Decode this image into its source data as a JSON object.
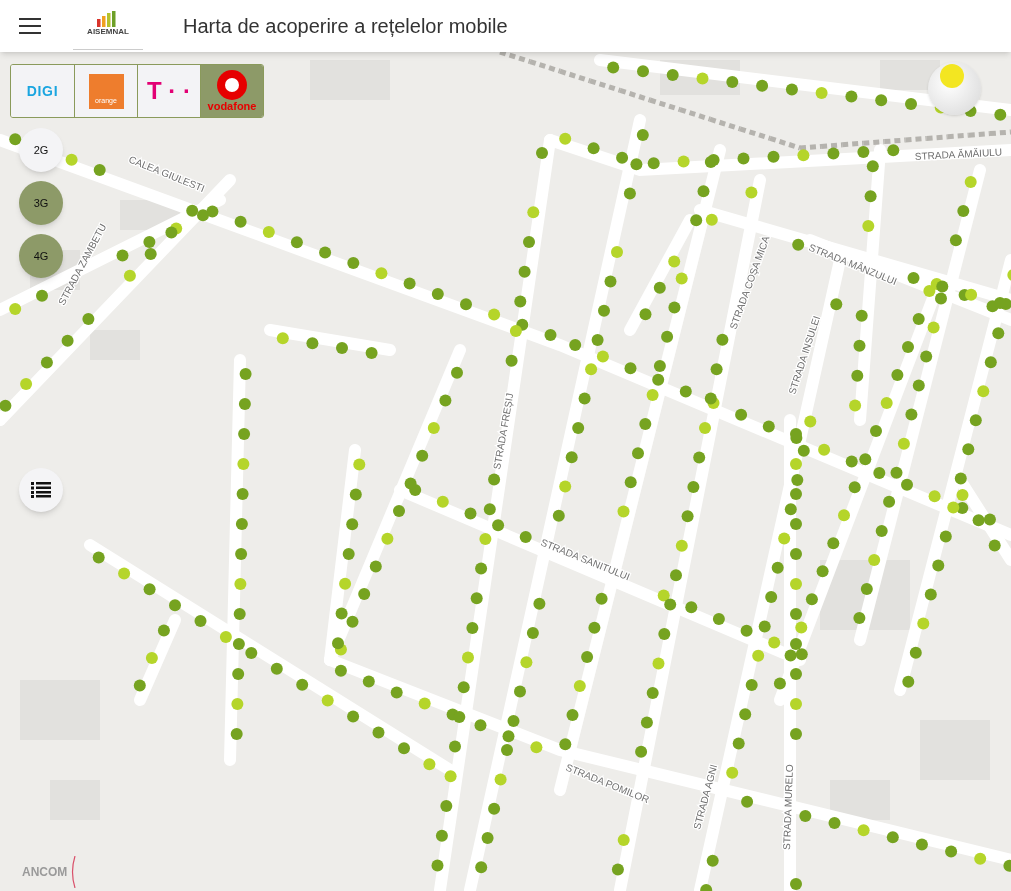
{
  "header": {
    "logo_text": "AISEMNAL",
    "title": "Harta de acoperire a rețelelor mobile"
  },
  "operators": [
    {
      "label": "DIGI",
      "kind": "digi",
      "selected": false
    },
    {
      "label": "orange",
      "kind": "orange",
      "selected": false
    },
    {
      "label": "T · ·",
      "kind": "telekom",
      "selected": false
    },
    {
      "label": "vodafone",
      "kind": "vodafone",
      "selected": true
    }
  ],
  "technologies": [
    {
      "label": "2G",
      "selected": false
    },
    {
      "label": "3G",
      "selected": true
    },
    {
      "label": "4G",
      "selected": true
    }
  ],
  "map": {
    "streets": [
      "CALEA GIULESTI",
      "STRADA ZAMBETU",
      "STRADA MÂNZULUI",
      "STRADA COȘA MICA",
      "STRADA INSULEI",
      "STRADA POMILOR",
      "STRADA AGNI",
      "STRADA MURELO",
      "STRADA SANITULUI",
      "STRADA FREȘIJ",
      "STRADA ĂMĂIULU"
    ],
    "attribution": "ANCOM"
  }
}
